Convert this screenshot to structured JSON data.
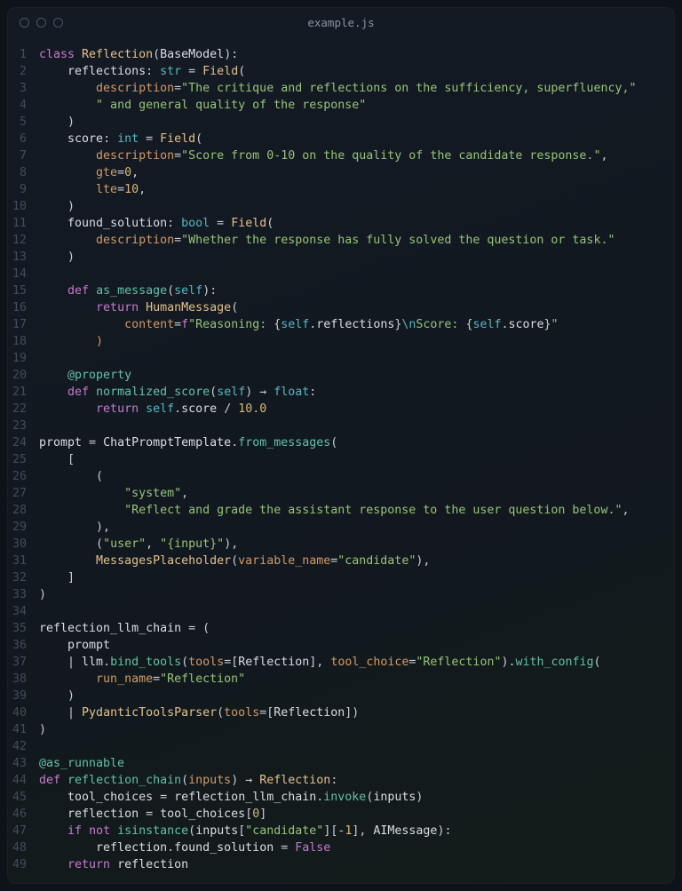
{
  "title": "example.js",
  "line_count": 49,
  "code_lines": [
    [
      [
        "kw",
        "class"
      ],
      [
        "op",
        " "
      ],
      [
        "ylw",
        "Reflection"
      ],
      [
        "op",
        "("
      ],
      [
        "cls",
        "BaseModel"
      ],
      [
        "op",
        "):"
      ]
    ],
    [
      [
        "op",
        "    "
      ],
      [
        "cls",
        "reflections"
      ],
      [
        "op",
        ": "
      ],
      [
        "type",
        "str"
      ],
      [
        "op",
        " = "
      ],
      [
        "ylw",
        "Field"
      ],
      [
        "op",
        "("
      ]
    ],
    [
      [
        "op",
        "        "
      ],
      [
        "param",
        "description"
      ],
      [
        "op",
        "="
      ],
      [
        "str",
        "\"The critique and reflections on the sufficiency, superfluency,\""
      ]
    ],
    [
      [
        "op",
        "        "
      ],
      [
        "str",
        "\" and general quality of the response\""
      ]
    ],
    [
      [
        "op",
        "    )"
      ]
    ],
    [
      [
        "op",
        "    "
      ],
      [
        "cls",
        "score"
      ],
      [
        "op",
        ": "
      ],
      [
        "type",
        "int"
      ],
      [
        "op",
        " = "
      ],
      [
        "ylw",
        "Field"
      ],
      [
        "op",
        "("
      ]
    ],
    [
      [
        "op",
        "        "
      ],
      [
        "param",
        "description"
      ],
      [
        "op",
        "="
      ],
      [
        "str",
        "\"Score from 0-10 on the quality of the candidate response.\""
      ],
      [
        "op",
        ","
      ]
    ],
    [
      [
        "op",
        "        "
      ],
      [
        "param",
        "gte"
      ],
      [
        "op",
        "="
      ],
      [
        "num",
        "0"
      ],
      [
        "op",
        ","
      ]
    ],
    [
      [
        "op",
        "        "
      ],
      [
        "param",
        "lte"
      ],
      [
        "op",
        "="
      ],
      [
        "num",
        "10"
      ],
      [
        "op",
        ","
      ]
    ],
    [
      [
        "op",
        "    )"
      ]
    ],
    [
      [
        "op",
        "    "
      ],
      [
        "cls",
        "found_solution"
      ],
      [
        "op",
        ": "
      ],
      [
        "type",
        "bool"
      ],
      [
        "op",
        " = "
      ],
      [
        "ylw",
        "Field"
      ],
      [
        "op",
        "("
      ]
    ],
    [
      [
        "op",
        "        "
      ],
      [
        "param",
        "description"
      ],
      [
        "op",
        "="
      ],
      [
        "str",
        "\"Whether the response has fully solved the question or task.\""
      ]
    ],
    [
      [
        "op",
        "    )"
      ]
    ],
    [
      [
        "op",
        ""
      ]
    ],
    [
      [
        "op",
        "    "
      ],
      [
        "kw",
        "def"
      ],
      [
        "op",
        " "
      ],
      [
        "fn",
        "as_message"
      ],
      [
        "op",
        "("
      ],
      [
        "type",
        "self"
      ],
      [
        "op",
        "):"
      ]
    ],
    [
      [
        "op",
        "        "
      ],
      [
        "kw",
        "return"
      ],
      [
        "op",
        " "
      ],
      [
        "ylw",
        "HumanMessage"
      ],
      [
        "op",
        "("
      ]
    ],
    [
      [
        "op",
        "            "
      ],
      [
        "param",
        "content"
      ],
      [
        "op",
        "="
      ],
      [
        "kw",
        "f"
      ],
      [
        "str",
        "\"Reasoning: "
      ],
      [
        "fbrace",
        "{"
      ],
      [
        "type",
        "self"
      ],
      [
        "op",
        "."
      ],
      [
        "cls",
        "reflections"
      ],
      [
        "fbrace",
        "}"
      ],
      [
        "esc",
        "\\n"
      ],
      [
        "str",
        "Score: "
      ],
      [
        "fbrace",
        "{"
      ],
      [
        "type",
        "self"
      ],
      [
        "op",
        "."
      ],
      [
        "cls",
        "score"
      ],
      [
        "fbrace",
        "}"
      ],
      [
        "str",
        "\""
      ]
    ],
    [
      [
        "op",
        "        "
      ],
      [
        "param",
        ")"
      ]
    ],
    [
      [
        "op",
        ""
      ]
    ],
    [
      [
        "op",
        "    "
      ],
      [
        "deco",
        "@property"
      ]
    ],
    [
      [
        "op",
        "    "
      ],
      [
        "kw",
        "def"
      ],
      [
        "op",
        " "
      ],
      [
        "fn",
        "normalized_score"
      ],
      [
        "op",
        "("
      ],
      [
        "type",
        "self"
      ],
      [
        "op",
        ") "
      ],
      [
        "op",
        "→"
      ],
      [
        "op",
        " "
      ],
      [
        "type",
        "float"
      ],
      [
        "op",
        ":"
      ]
    ],
    [
      [
        "op",
        "        "
      ],
      [
        "kw",
        "return"
      ],
      [
        "op",
        " "
      ],
      [
        "type",
        "self"
      ],
      [
        "op",
        "."
      ],
      [
        "cls",
        "score"
      ],
      [
        "op",
        " / "
      ],
      [
        "num",
        "10.0"
      ]
    ],
    [
      [
        "op",
        ""
      ]
    ],
    [
      [
        "cls",
        "prompt"
      ],
      [
        "op",
        " = "
      ],
      [
        "cls",
        "ChatPromptTemplate"
      ],
      [
        "op",
        "."
      ],
      [
        "fn",
        "from_messages"
      ],
      [
        "op",
        "("
      ]
    ],
    [
      [
        "op",
        "    ["
      ]
    ],
    [
      [
        "op",
        "        ("
      ]
    ],
    [
      [
        "op",
        "            "
      ],
      [
        "str",
        "\"system\""
      ],
      [
        "op",
        ","
      ]
    ],
    [
      [
        "op",
        "            "
      ],
      [
        "str",
        "\"Reflect and grade the assistant response to the user question below.\""
      ],
      [
        "op",
        ","
      ]
    ],
    [
      [
        "op",
        "        ),"
      ]
    ],
    [
      [
        "op",
        "        ("
      ],
      [
        "str",
        "\"user\""
      ],
      [
        "op",
        ", "
      ],
      [
        "str",
        "\"{input}\""
      ],
      [
        "op",
        "),"
      ]
    ],
    [
      [
        "op",
        "        "
      ],
      [
        "ylw",
        "MessagesPlaceholder"
      ],
      [
        "op",
        "("
      ],
      [
        "param",
        "variable_name"
      ],
      [
        "op",
        "="
      ],
      [
        "str",
        "\"candidate\""
      ],
      [
        "op",
        "),"
      ]
    ],
    [
      [
        "op",
        "    ]"
      ]
    ],
    [
      [
        "op",
        ")"
      ]
    ],
    [
      [
        "op",
        ""
      ]
    ],
    [
      [
        "cls",
        "reflection_llm_chain"
      ],
      [
        "op",
        " = ("
      ]
    ],
    [
      [
        "op",
        "    "
      ],
      [
        "cls",
        "prompt"
      ]
    ],
    [
      [
        "op",
        "    | "
      ],
      [
        "cls",
        "llm"
      ],
      [
        "op",
        "."
      ],
      [
        "fn",
        "bind_tools"
      ],
      [
        "op",
        "("
      ],
      [
        "param",
        "tools"
      ],
      [
        "op",
        "=["
      ],
      [
        "cls",
        "Reflection"
      ],
      [
        "op",
        "], "
      ],
      [
        "param",
        "tool_choice"
      ],
      [
        "op",
        "="
      ],
      [
        "str",
        "\"Reflection\""
      ],
      [
        "op",
        ")."
      ],
      [
        "fn",
        "with_config"
      ],
      [
        "op",
        "("
      ]
    ],
    [
      [
        "op",
        "        "
      ],
      [
        "param",
        "run_name"
      ],
      [
        "op",
        "="
      ],
      [
        "str",
        "\"Reflection\""
      ]
    ],
    [
      [
        "op",
        "    )"
      ]
    ],
    [
      [
        "op",
        "    | "
      ],
      [
        "ylw",
        "PydanticToolsParser"
      ],
      [
        "op",
        "("
      ],
      [
        "param",
        "tools"
      ],
      [
        "op",
        "=["
      ],
      [
        "cls",
        "Reflection"
      ],
      [
        "op",
        "])"
      ]
    ],
    [
      [
        "op",
        ")"
      ]
    ],
    [
      [
        "op",
        ""
      ]
    ],
    [
      [
        "deco",
        "@as_runnable"
      ]
    ],
    [
      [
        "kw",
        "def"
      ],
      [
        "op",
        " "
      ],
      [
        "fn",
        "reflection_chain"
      ],
      [
        "op",
        "("
      ],
      [
        "param",
        "inputs"
      ],
      [
        "op",
        ") "
      ],
      [
        "op",
        "→"
      ],
      [
        "op",
        " "
      ],
      [
        "ylw",
        "Reflection"
      ],
      [
        "op",
        ":"
      ]
    ],
    [
      [
        "op",
        "    "
      ],
      [
        "cls",
        "tool_choices"
      ],
      [
        "op",
        " = "
      ],
      [
        "cls",
        "reflection_llm_chain"
      ],
      [
        "op",
        "."
      ],
      [
        "fn",
        "invoke"
      ],
      [
        "op",
        "("
      ],
      [
        "cls",
        "inputs"
      ],
      [
        "op",
        ")"
      ]
    ],
    [
      [
        "op",
        "    "
      ],
      [
        "cls",
        "reflection"
      ],
      [
        "op",
        " = "
      ],
      [
        "cls",
        "tool_choices"
      ],
      [
        "op",
        "["
      ],
      [
        "num",
        "0"
      ],
      [
        "op",
        "]"
      ]
    ],
    [
      [
        "op",
        "    "
      ],
      [
        "kw",
        "if"
      ],
      [
        "op",
        " "
      ],
      [
        "kw",
        "not"
      ],
      [
        "op",
        " "
      ],
      [
        "fn",
        "isinstance"
      ],
      [
        "op",
        "("
      ],
      [
        "cls",
        "inputs"
      ],
      [
        "op",
        "["
      ],
      [
        "str",
        "\"candidate\""
      ],
      [
        "op",
        "][-"
      ],
      [
        "num",
        "1"
      ],
      [
        "op",
        "], "
      ],
      [
        "cls",
        "AIMessage"
      ],
      [
        "op",
        "):"
      ]
    ],
    [
      [
        "op",
        "        "
      ],
      [
        "cls",
        "reflection"
      ],
      [
        "op",
        "."
      ],
      [
        "cls",
        "found_solution"
      ],
      [
        "op",
        " = "
      ],
      [
        "kw",
        "False"
      ]
    ],
    [
      [
        "op",
        "    "
      ],
      [
        "kw",
        "return"
      ],
      [
        "op",
        " "
      ],
      [
        "cls",
        "reflection"
      ]
    ]
  ]
}
